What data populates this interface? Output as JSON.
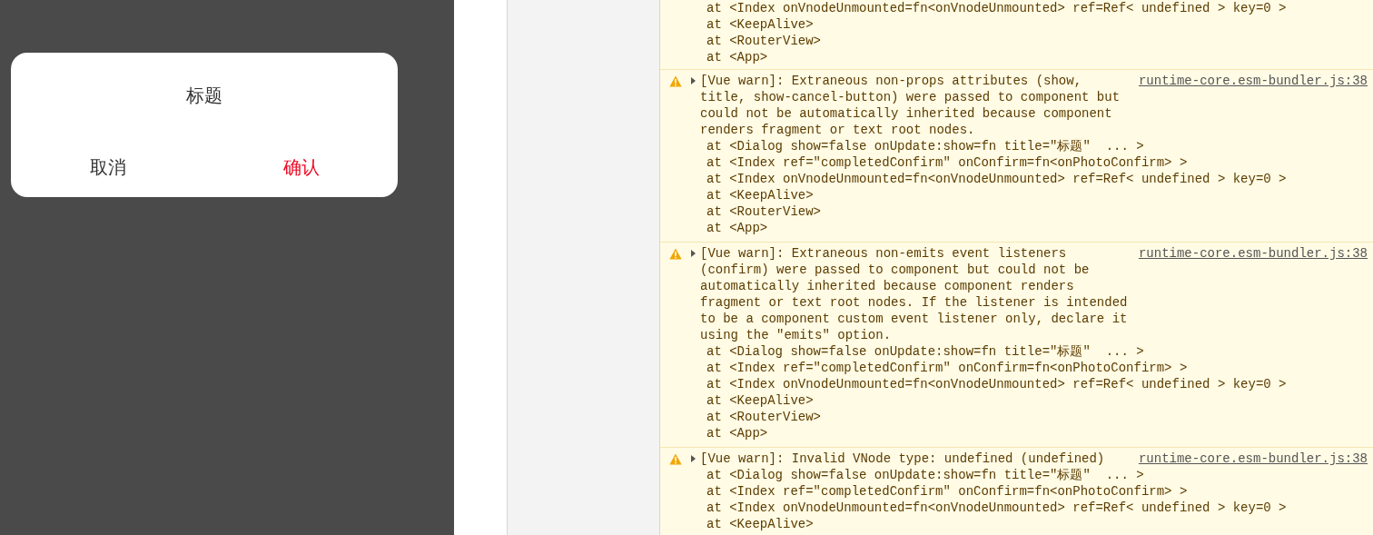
{
  "app_preview": {
    "dialog": {
      "title": "标题",
      "cancel_button": "取消",
      "confirm_button": "确认"
    }
  },
  "console": {
    "messages": [
      {
        "kind": "continued",
        "stack": [
          "at <Index onVnodeUnmounted=fn<onVnodeUnmounted> ref=Ref< undefined > key=0 >",
          "at <KeepAlive>",
          "at <RouterView>",
          "at <App>"
        ]
      },
      {
        "kind": "warning",
        "expanded": false,
        "text": "[Vue warn]: Extraneous non-props attributes (show, title, show-cancel-button) were passed to component but could not be automatically inherited because component renders fragment or text root nodes.",
        "source": "runtime-core.esm-bundler.js:38",
        "stack": [
          "at <Dialog show=false onUpdate:show=fn title=\"标题\"  ... >",
          "at <Index ref=\"completedConfirm\" onConfirm=fn<onPhotoConfirm> >",
          "at <Index onVnodeUnmounted=fn<onVnodeUnmounted> ref=Ref< undefined > key=0 >",
          "at <KeepAlive>",
          "at <RouterView>",
          "at <App>"
        ]
      },
      {
        "kind": "warning",
        "expanded": false,
        "text": "[Vue warn]: Extraneous non-emits event listeners (confirm) were passed to component but could not be automatically inherited because component renders fragment or text root nodes. If the listener is intended to be a component custom event listener only, declare it using the \"emits\" option.",
        "source": "runtime-core.esm-bundler.js:38",
        "stack": [
          "at <Dialog show=false onUpdate:show=fn title=\"标题\"  ... >",
          "at <Index ref=\"completedConfirm\" onConfirm=fn<onPhotoConfirm> >",
          "at <Index onVnodeUnmounted=fn<onVnodeUnmounted> ref=Ref< undefined > key=0 >",
          "at <KeepAlive>",
          "at <RouterView>",
          "at <App>"
        ]
      },
      {
        "kind": "warning",
        "expanded": false,
        "text": "[Vue warn]: Invalid VNode type: undefined (undefined)",
        "source": "runtime-core.esm-bundler.js:38",
        "stack": [
          "at <Dialog show=false onUpdate:show=fn title=\"标题\"  ... >",
          "at <Index ref=\"completedConfirm\" onConfirm=fn<onPhotoConfirm> >",
          "at <Index onVnodeUnmounted=fn<onVnodeUnmounted> ref=Ref< undefined > key=0 >",
          "at <KeepAlive>"
        ]
      }
    ]
  }
}
